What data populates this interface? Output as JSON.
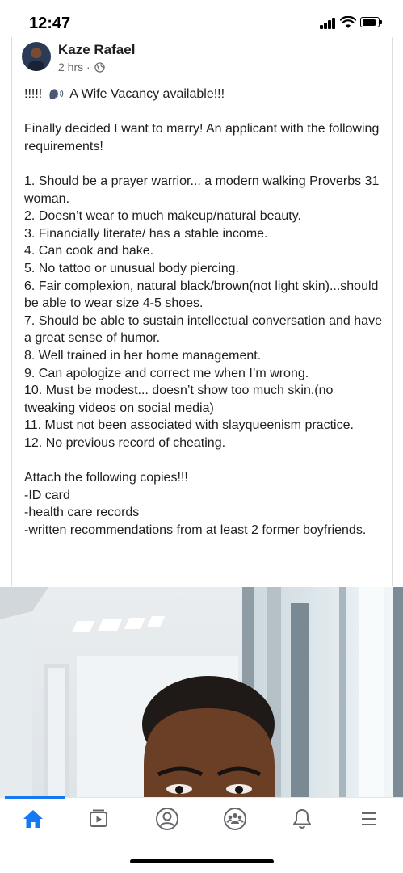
{
  "status_bar": {
    "time": "12:47"
  },
  "post": {
    "author": "Kaze Rafael",
    "time": "2 hrs ·",
    "title_prefix": "!!!!!",
    "title": "A Wife Vacancy available!!!",
    "intro": "Finally decided I want to marry! An applicant with the following requirements!",
    "requirements": [
      "1. Should be a prayer warrior... a modern walking Proverbs 31 woman.",
      "2. Doesn’t wear to much makeup/natural beauty.",
      "3. Financially literate/ has a stable income.",
      "4. Can cook and bake.",
      "5. No tattoo or unusual body piercing.",
      "6. Fair complexion, natural black/brown(not light skin)...should be able to wear size 4-5 shoes.",
      "7. Should be able to sustain intellectual conversation and have a great sense of humor.",
      "8. Well trained in her home management.",
      "9. Can apologize and correct me when I’m wrong.",
      "10. Must be modest... doesn’t show too much skin.(no tweaking videos on social media)",
      "11. Must not been associated with slayqueenism practice.",
      "12. No previous record of cheating."
    ],
    "attach_heading": "Attach the following copies!!!",
    "attachments": [
      "-ID card",
      "-health care records",
      "-written recommendations from at least 2 former boyfriends."
    ]
  },
  "tab_bar": {
    "active": "home",
    "icons": [
      "home-icon",
      "video-icon",
      "profile-icon",
      "groups-icon",
      "notifications-icon",
      "menu-icon"
    ]
  },
  "colors": {
    "accent": "#1877f2",
    "text": "#1c1e21",
    "secondary": "#65676b",
    "icon": "#65676b"
  }
}
